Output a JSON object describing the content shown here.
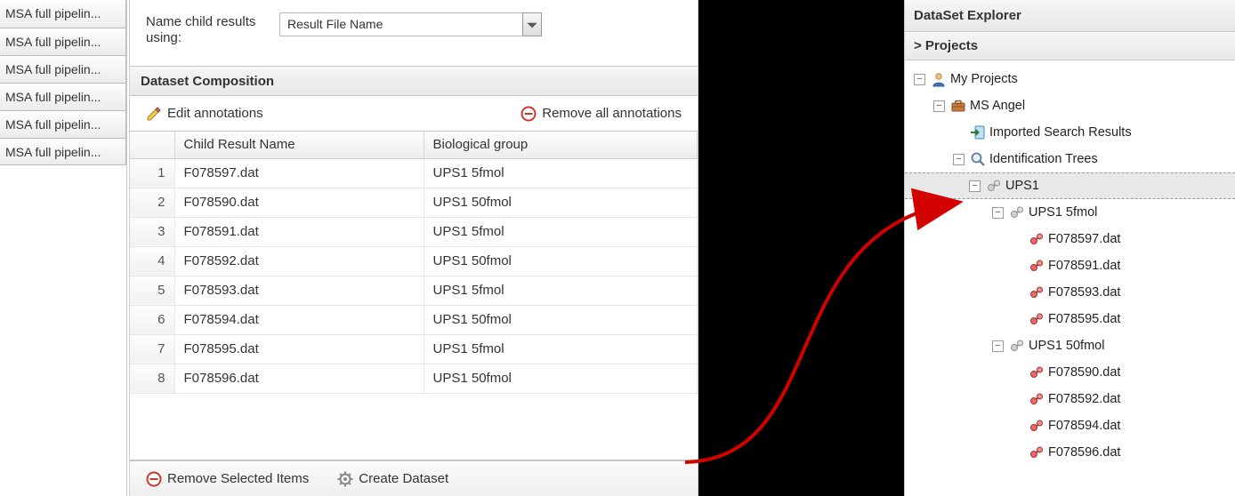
{
  "left_tabs": [
    "MSA full pipelin...",
    "MSA full pipelin...",
    "MSA full pipelin...",
    "MSA full pipelin...",
    "MSA full pipelin...",
    "MSA full pipelin..."
  ],
  "form": {
    "name_label": "Name child results using:",
    "select_value": "Result File Name"
  },
  "composition": {
    "header": "Dataset Composition",
    "edit_label": "Edit annotations",
    "remove_all_label": "Remove all annotations",
    "columns": [
      "",
      "Child Result Name",
      "Biological group"
    ],
    "rows": [
      {
        "n": "1",
        "name": "F078597.dat",
        "group": "UPS1 5fmol"
      },
      {
        "n": "2",
        "name": "F078590.dat",
        "group": "UPS1 50fmol"
      },
      {
        "n": "3",
        "name": "F078591.dat",
        "group": "UPS1 5fmol"
      },
      {
        "n": "4",
        "name": "F078592.dat",
        "group": "UPS1 50fmol"
      },
      {
        "n": "5",
        "name": "F078593.dat",
        "group": "UPS1 5fmol"
      },
      {
        "n": "6",
        "name": "F078594.dat",
        "group": "UPS1 50fmol"
      },
      {
        "n": "7",
        "name": "F078595.dat",
        "group": "UPS1 5fmol"
      },
      {
        "n": "8",
        "name": "F078596.dat",
        "group": "UPS1 50fmol"
      }
    ]
  },
  "footer": {
    "remove_label": "Remove Selected Items",
    "create_label": "Create Dataset"
  },
  "explorer": {
    "title": "DataSet Explorer",
    "breadcrumb": "> Projects",
    "nodes": [
      {
        "depth": 0,
        "exp": "-",
        "icon": "person",
        "label": "My Projects",
        "sel": false
      },
      {
        "depth": 1,
        "exp": "-",
        "icon": "briefcase",
        "label": "MS Angel",
        "sel": false
      },
      {
        "depth": 2,
        "exp": "",
        "icon": "import",
        "label": "Imported Search Results",
        "sel": false
      },
      {
        "depth": 2,
        "exp": "-",
        "icon": "lens",
        "label": "Identification Trees",
        "sel": false
      },
      {
        "depth": 3,
        "exp": "-",
        "icon": "grey-mol",
        "label": "UPS1",
        "sel": true
      },
      {
        "depth": 4,
        "exp": "-",
        "icon": "grey-mol",
        "label": "UPS1 5fmol",
        "sel": false
      },
      {
        "depth": 5,
        "exp": "",
        "icon": "red-mol",
        "label": "F078597.dat",
        "sel": false
      },
      {
        "depth": 5,
        "exp": "",
        "icon": "red-mol",
        "label": "F078591.dat",
        "sel": false
      },
      {
        "depth": 5,
        "exp": "",
        "icon": "red-mol",
        "label": "F078593.dat",
        "sel": false
      },
      {
        "depth": 5,
        "exp": "",
        "icon": "red-mol",
        "label": "F078595.dat",
        "sel": false
      },
      {
        "depth": 4,
        "exp": "-",
        "icon": "grey-mol",
        "label": "UPS1 50fmol",
        "sel": false
      },
      {
        "depth": 5,
        "exp": "",
        "icon": "red-mol",
        "label": "F078590.dat",
        "sel": false
      },
      {
        "depth": 5,
        "exp": "",
        "icon": "red-mol",
        "label": "F078592.dat",
        "sel": false
      },
      {
        "depth": 5,
        "exp": "",
        "icon": "red-mol",
        "label": "F078594.dat",
        "sel": false
      },
      {
        "depth": 5,
        "exp": "",
        "icon": "red-mol",
        "label": "F078596.dat",
        "sel": false
      }
    ]
  }
}
